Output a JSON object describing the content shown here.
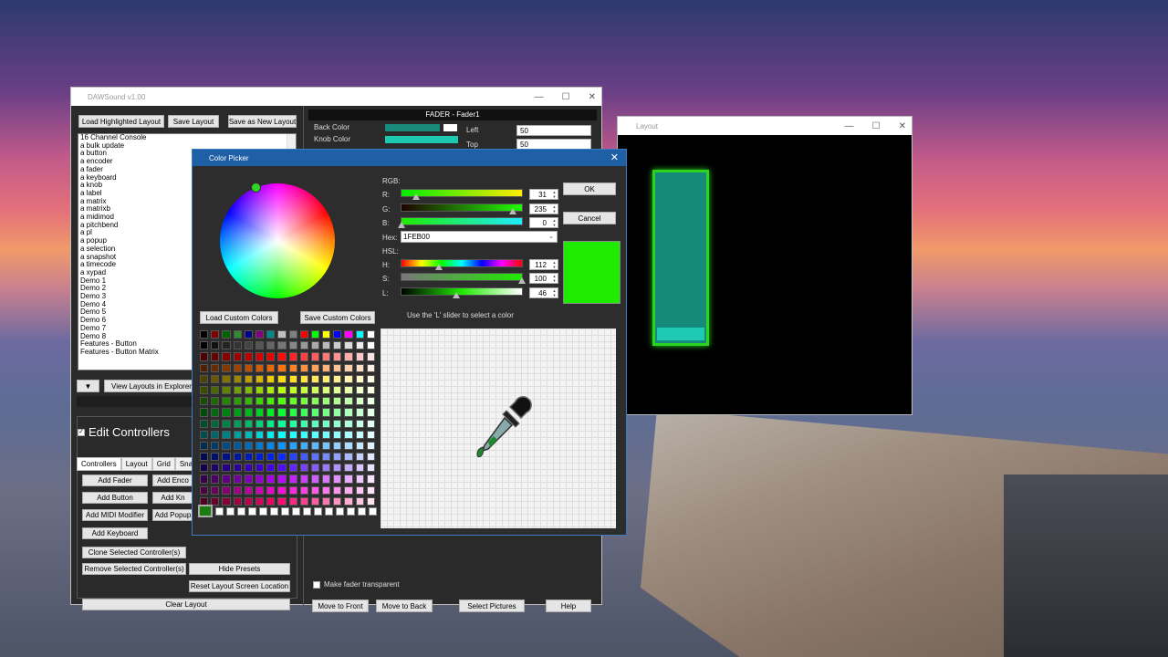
{
  "daw": {
    "title": "DAWSound  v1.00",
    "buttons": {
      "load_highlighted": "Load Highlighted Layout",
      "save_layout": "Save Layout",
      "save_new": "Save as New Layout",
      "view_explorer": "View Layouts in Explorer",
      "dropdown": "▼"
    },
    "layouts": [
      "16 Channel Console",
      "a bulk update",
      "a button",
      "a encoder",
      "a fader",
      "a keyboard",
      "a knob",
      "a label",
      "a matrix",
      "a matrixb",
      "a midimod",
      "a pitchbend",
      "a pl",
      "a popup",
      "a selection",
      "a snapshot",
      "a timecode",
      "a xypad",
      "Demo 1",
      "Demo 2",
      "Demo 3",
      "Demo 4",
      "Demo 5",
      "Demo 6",
      "Demo 7",
      "Demo 8",
      "Features - Button",
      "Features - Button Matrix"
    ],
    "edit_controllers": "Edit Controllers",
    "tabs": [
      "Controllers",
      "Layout",
      "Grid",
      "Snapsh"
    ],
    "ctrl_buttons": {
      "add_fader": "Add Fader",
      "add_enc": "Add Enco",
      "add_button": "Add Button",
      "add_kn": "Add Kn",
      "add_midi": "Add MIDI Modifier",
      "add_popup": "Add Popup",
      "add_keyboard": "Add Keyboard",
      "clone": "Clone Selected Controller(s)",
      "remove": "Remove Selected Controller(s)",
      "hide_presets": "Hide Presets",
      "reset_location": "Reset Layout Screen Location",
      "clear_layout": "Clear Layout"
    },
    "props": {
      "header": "FADER  -  Fader1",
      "back_color": "Back Color",
      "knob_color": "Knob Color",
      "left_label": "Left",
      "left_value": "50",
      "top_label": "Top",
      "top_value": "50",
      "transparent": "Make fader transparent",
      "move_front": "Move to Front",
      "move_back": "Move to Back",
      "select_pictures": "Select Pictures",
      "help": "Help"
    }
  },
  "layout_window": {
    "title": "Layout"
  },
  "color_picker": {
    "title": "Color Picker",
    "rgb_label": "RGB:",
    "r_label": "R:",
    "r_value": "31",
    "g_label": "G:",
    "g_value": "235",
    "b_label": "B:",
    "b_value": "0",
    "hex_label": "Hex:",
    "hex_value": "1FEB00",
    "hsl_label": "HSL:",
    "h_label": "H:",
    "h_value": "112",
    "s_label": "S:",
    "s_value": "100",
    "l_label": "L:",
    "l_value": "46",
    "ok": "OK",
    "cancel": "Cancel",
    "load_custom": "Load Custom Colors",
    "save_custom": "Save Custom Colors",
    "hint": "Use the 'L' slider to select a color",
    "selected_color": "#1FEB00"
  },
  "window_controls": {
    "minimize": "—",
    "maximize": "☐",
    "close": "✕"
  }
}
